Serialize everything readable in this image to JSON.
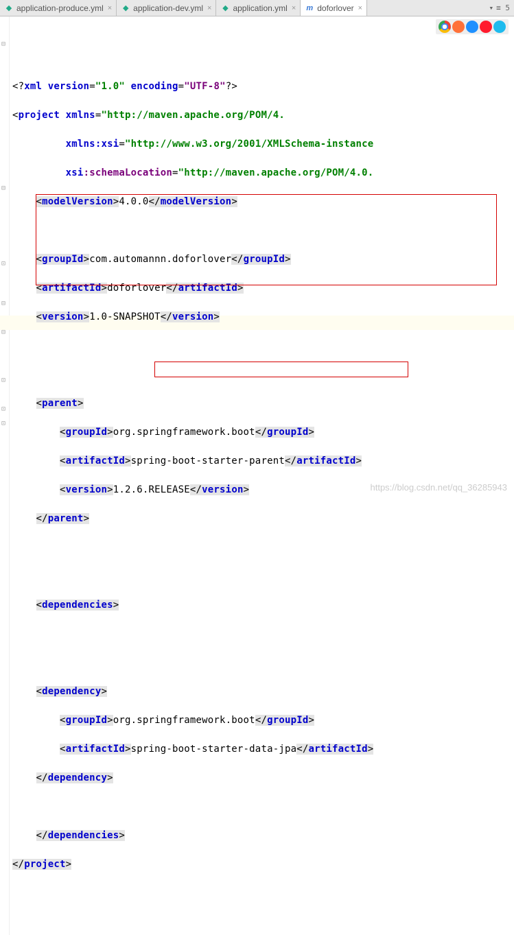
{
  "tabs": [
    {
      "label": "application-produce.yml",
      "iconText": "◆",
      "active": false
    },
    {
      "label": "application-dev.yml",
      "iconText": "◆",
      "active": false
    },
    {
      "label": "application.yml",
      "iconText": "◆",
      "active": false
    },
    {
      "label": "doforlover",
      "iconText": "m",
      "active": true
    }
  ],
  "rightControl": "≡ 5",
  "xml": {
    "decl": {
      "version": "\"1.0\"",
      "encoding": "\"UTF-8\""
    },
    "xmlns": "\"http://maven.apache.org/POM/4.",
    "xmlns_xsi": "\"http://www.w3.org/2001/XMLSchema-instance",
    "schemaLocation": "\"http://maven.apache.org/POM/4.0.",
    "modelVersion": "4.0.0",
    "groupId": "com.automannn.doforlover",
    "artifactId": "doforlover",
    "version": "1.0-SNAPSHOT",
    "parent": {
      "groupId": "org.springframework.boot",
      "artifactId": "spring-boot-starter-parent",
      "version": "1.2.6.RELEASE"
    },
    "dep": {
      "groupId": "org.springframework.boot",
      "artifactId": "spring-boot-starter-data-jpa"
    }
  },
  "watermark": "https://blog.csdn.net/qq_36285943"
}
